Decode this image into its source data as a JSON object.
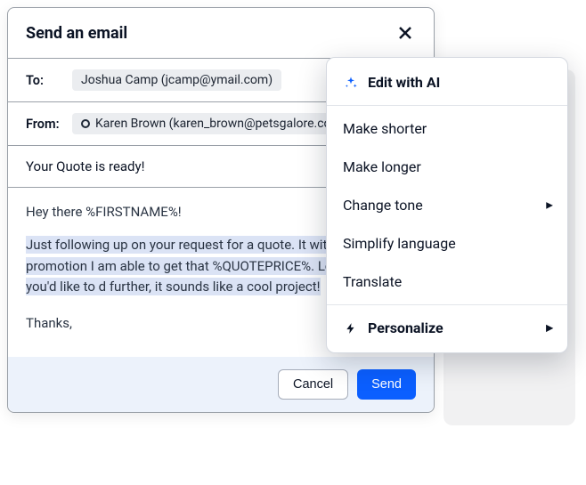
{
  "dialog": {
    "title": "Send an email",
    "to_label": "To:",
    "to_value": "Joshua Camp (jcamp@ymail.com)",
    "from_label": "From:",
    "from_value": "Karen Brown (karen_brown@petsgalore.co",
    "subject": "Your Quote is ready!",
    "body": {
      "greeting": "Hey there %FIRSTNAME%!",
      "highlighted": "Just following up on your request for a quote. It with the current promotion I am able to get that %QUOTEPRICE%. Let me know if you'd like to d further, it sounds like a cool project!",
      "signoff": "Thanks,"
    },
    "cancel": "Cancel",
    "send": "Send"
  },
  "menu": {
    "header": "Edit with AI",
    "items": [
      {
        "label": "Make shorter",
        "submenu": false
      },
      {
        "label": "Make longer",
        "submenu": false
      },
      {
        "label": "Change tone",
        "submenu": true
      },
      {
        "label": "Simplify language",
        "submenu": false
      },
      {
        "label": "Translate",
        "submenu": false
      }
    ],
    "personalize": "Personalize"
  }
}
